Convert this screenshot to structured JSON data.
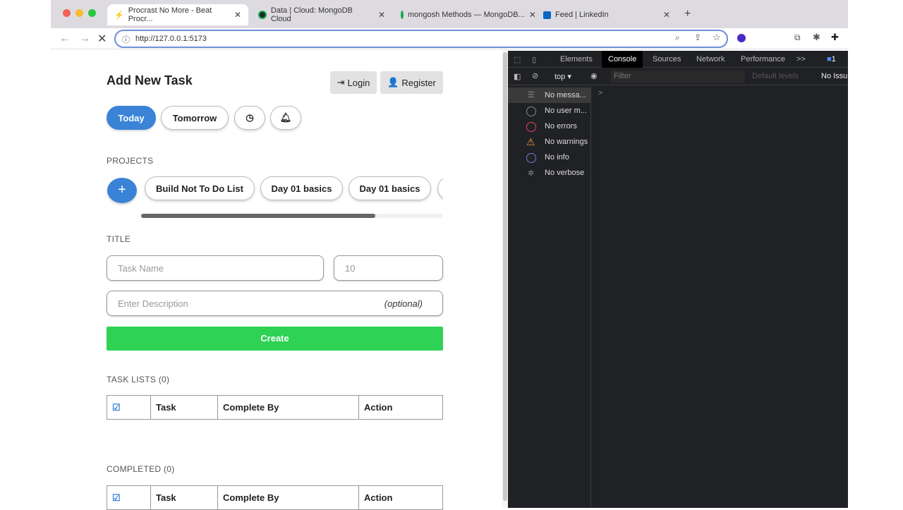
{
  "browser": {
    "tabs": [
      {
        "title": "Procrast No More - Beat Procr...",
        "active": true
      },
      {
        "title": "Data | Cloud: MongoDB Cloud"
      },
      {
        "title": "mongosh Methods — MongoDB..."
      },
      {
        "title": "Feed | LinkedIn"
      }
    ],
    "url": "http://127.0.0.1:5173"
  },
  "page": {
    "heading": "Add New Task",
    "login": "Login",
    "register": "Register",
    "day_buttons": [
      "Today",
      "Tomorrow"
    ],
    "projects_label": "PROJECTS",
    "add_project": "+",
    "projects": [
      "Build Not To Do List",
      "Day 01 basics",
      "Day 01 basics"
    ],
    "title_label": "TITLE",
    "task_name_placeholder": "Task Name",
    "hours_placeholder": "10",
    "description_placeholder": "Enter Description",
    "optional": "(optional)",
    "create": "Create",
    "task_lists_label": "TASK LISTS (0)",
    "completed_label": "COMPLETED (0)",
    "columns": [
      "Task",
      "Complete By",
      "Action"
    ],
    "colors": {
      "today": "#3a83d6",
      "create": "#2ed255"
    }
  },
  "devtools": {
    "tabs": [
      "Elements",
      "Console",
      "Sources",
      "Network",
      "Performance"
    ],
    "more": ">>",
    "issues_badge": "1",
    "context": "top",
    "filter_placeholder": "Filter",
    "levels": "Default levels",
    "no_issues": "No Issu",
    "sidebar": [
      "No messa...",
      "No user m...",
      "No errors",
      "No warnings",
      "No info",
      "No verbose"
    ],
    "prompt": ">"
  }
}
